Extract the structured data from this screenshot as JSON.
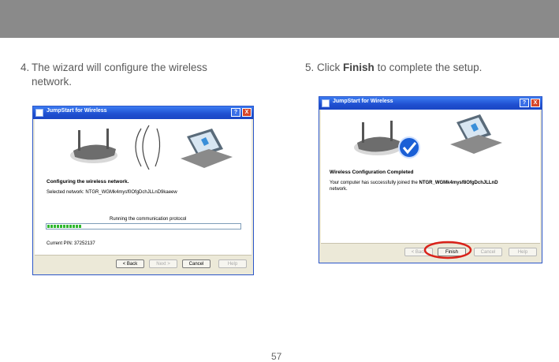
{
  "step4": {
    "number": "4.",
    "text": "The wizard will configure the wireless network."
  },
  "step5": {
    "number": "5.",
    "text_before": "Click",
    "action": "Finish",
    "text_after": "to complete the setup."
  },
  "page_number": "57",
  "dialog_left": {
    "title": "JumpStart for Wireless",
    "help_btn": "?",
    "close_btn": "X",
    "heading": "Configuring the wireless network.",
    "selected_network": "Selected network: NTGR_WGMk4mysf0OfgDchJLLnD9kaeew",
    "progress_label": "Running the communication protocol",
    "progress_fraction": 0.18,
    "pin": "Current PIN: 37252137",
    "buttons": {
      "back": "< Back",
      "next": "Next >",
      "cancel": "Cancel",
      "help": "Help"
    }
  },
  "dialog_right": {
    "title": "JumpStart for Wireless",
    "help_btn": "?",
    "close_btn": "X",
    "heading": "Wireless Configuration Completed",
    "message_line1": "Your computer has successfully joined the",
    "network": "NTGR_WGMk4mysf8OfgDchJLLnD",
    "message_line2": "network.",
    "buttons": {
      "back": "< Back",
      "finish": "Finish",
      "cancel": "Cancel",
      "help": "Help"
    }
  },
  "colors": {
    "titlebar": "#1f4fd0",
    "highlight": "#d9221a",
    "progress": "#2fb82f",
    "check": "#1a5fd6"
  }
}
